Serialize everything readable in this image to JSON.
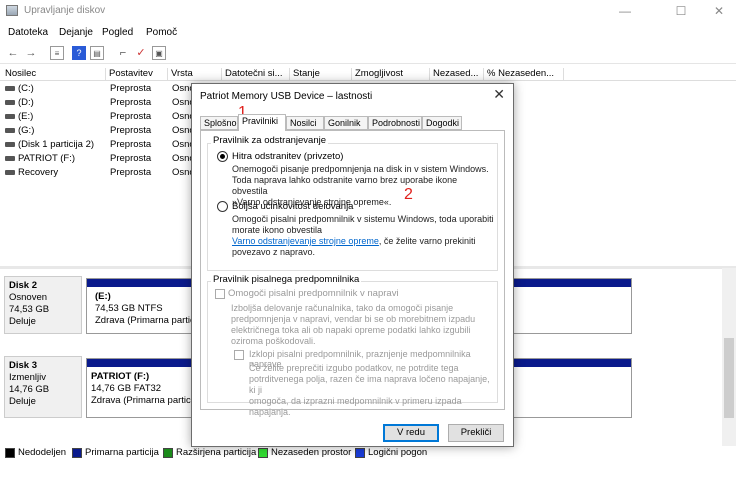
{
  "window": {
    "title": "Upravljanje diskov",
    "controls": {
      "minimize": "—",
      "maximize": "☐",
      "close": "✕"
    }
  },
  "menu": [
    "Datoteka",
    "Dejanje",
    "Pogled",
    "Pomoč"
  ],
  "toolbar_icons": [
    "back-arrow-icon",
    "forward-arrow-icon",
    "list-view-icon",
    "help-icon",
    "properties-icon",
    "connect-icon",
    "check-icon",
    "console-icon"
  ],
  "columns": [
    "Nosilec",
    "Postavitev",
    "Vrsta",
    "Datotečni si...",
    "Stanje",
    "Zmogljivost",
    "Nezased...",
    "% Nezaseden..."
  ],
  "volumes": [
    {
      "name": "(C:)",
      "layout": "Preprosta",
      "type": "Osno"
    },
    {
      "name": "(D:)",
      "layout": "Preprosta",
      "type": "Osno"
    },
    {
      "name": "(E:)",
      "layout": "Preprosta",
      "type": "Osno"
    },
    {
      "name": "(G:)",
      "layout": "Preprosta",
      "type": "Osno"
    },
    {
      "name": "(Disk 1 particija 2)",
      "layout": "Preprosta",
      "type": "Osno"
    },
    {
      "name": "PATRIOT (F:)",
      "layout": "Preprosta",
      "type": "Osno"
    },
    {
      "name": "Recovery",
      "layout": "Preprosta",
      "type": "Osno"
    }
  ],
  "disks": [
    {
      "name": "Disk 2",
      "kind": "Osnoven",
      "size": "74,53 GB",
      "status": "Deluje",
      "partition": {
        "label": "(E:)",
        "detail": "74,53 GB NTFS",
        "health": "Zdrava (Primarna partic"
      }
    },
    {
      "name": "Disk 3",
      "kind": "Izmenljiv",
      "size": "14,76 GB",
      "status": "Deluje",
      "partition": {
        "label": "PATRIOT  (F:)",
        "detail": "14,76 GB FAT32",
        "health": "Zdrava (Primarna partic"
      }
    }
  ],
  "legend": [
    {
      "label": "Nedodeljen",
      "color": "#000000"
    },
    {
      "label": "Primarna particija",
      "color": "#0a1a8c"
    },
    {
      "label": "Razširjena particija",
      "color": "#1a8a1a"
    },
    {
      "label": "Nezaseden prostor",
      "color": "#33dd33"
    },
    {
      "label": "Logični pogon",
      "color": "#1a3cd8"
    }
  ],
  "dialog": {
    "title": "Patriot Memory USB Device – lastnosti",
    "close": "✕",
    "tabs": [
      "Splošno",
      "Pravilniki",
      "Nosilci",
      "Gonilnik",
      "Podrobnosti",
      "Dogodki"
    ],
    "active_tab": "Pravilniki",
    "removal_group": "Pravilnik za odstranjevanje",
    "quick_label": "Hitra odstranitev (privzeto)",
    "quick_desc": [
      "Onemogoči pisanje predpomnjenja na disk in v sistem Windows.",
      "Toda naprava lahko odstranite varno brez uporabe ikone obvestila",
      "»Varno odstranjevanje strojne opreme«."
    ],
    "better_label": "Boljša učinkovitost delovanja",
    "better_desc": [
      "Omogoči pisalni predpomnilnik v sistemu Windows, toda uporabiti",
      "morate ikono obvestila"
    ],
    "better_link": "Varno odstranjevanje strojne opreme",
    "better_tail": ", če želite varno prekiniti",
    "better_tail2": "povezavo z napravo.",
    "write_group": "Pravilnik pisalnega predpomnilnika",
    "enable_cache": "Omogoči pisalni predpomnilnik v napravi",
    "enable_desc": [
      "Izboljša delovanje  računalnika, tako da omogoči  pisanje",
      "predpomnjenja v napravi, vendar bi se ob morebitnem izpadu",
      "električnega toka ali ob napaki opreme podatki lahko izgubili",
      "oziroma poškodovali."
    ],
    "disable_flush": "Izklopi pisalni predpomnilnik, praznjenje medpomnilnika naprave",
    "disable_desc": [
      "Če želite preprečiti izgubo podatkov, ne potrdite tega",
      "potrditvenega polja, razen če ima naprava ločeno napajanje, ki ji",
      "omogoča, da izprazni medpomnilnik v primeru izpada napajanja."
    ],
    "ok": "V redu",
    "cancel": "Prekliči"
  },
  "annotations": {
    "one": "1",
    "two": "2"
  }
}
